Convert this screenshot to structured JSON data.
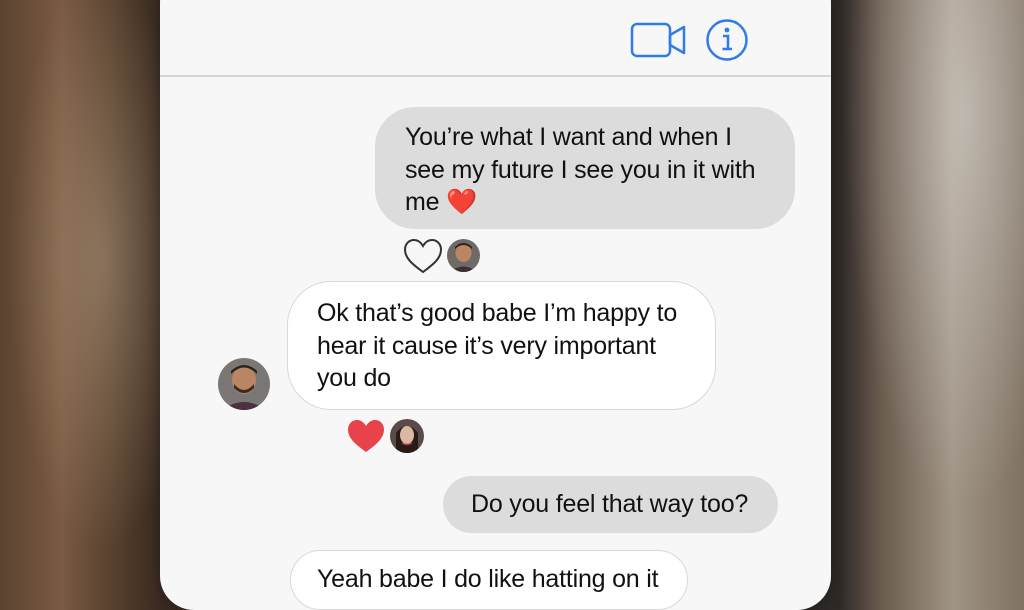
{
  "header": {
    "video_icon": "video-camera-icon",
    "info_icon": "info-icon"
  },
  "messages": [
    {
      "direction": "outgoing",
      "text": "You’re what I want and when I see my future I see you in it with me ❤️"
    },
    {
      "direction": "incoming",
      "text": "Ok that’s good babe I’m happy to hear it cause it’s very important you do"
    },
    {
      "direction": "outgoing",
      "text": "Do you feel that way too?"
    },
    {
      "direction": "incoming",
      "text": "Yeah babe I do like hatting on it"
    }
  ],
  "reactions": [
    {
      "icon": "heart-outline-icon",
      "reactor_avatar": "male-avatar"
    },
    {
      "icon": "heart-filled-icon",
      "reactor_avatar": "female-avatar"
    }
  ],
  "colors": {
    "accent": "#2f7ce6",
    "outgoing_bubble": "#dcdcdc",
    "incoming_bubble": "#ffffff",
    "heart_red": "#e8434a"
  }
}
